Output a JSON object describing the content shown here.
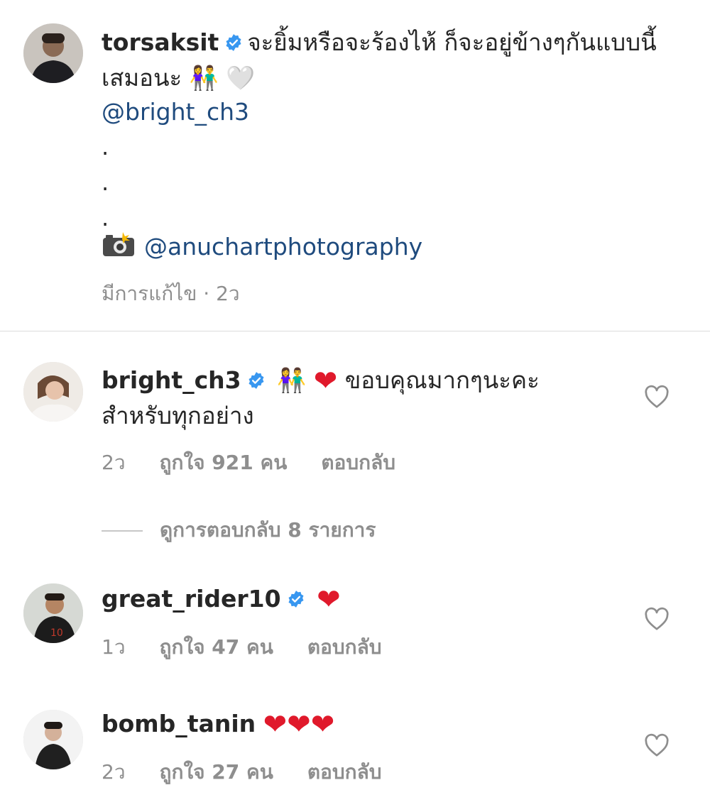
{
  "caption": {
    "username": "torsaksit",
    "text_line1": "จะยิ้มหรือจะร้องไห้ ก็จะอยู่ข้างๆกันแบบนี้",
    "text_line2": "เสมอนะ",
    "emoji_couple": "👫",
    "emoji_heart": "🤍",
    "mention": "@bright_ch3",
    "dots": [
      ".",
      ".",
      "."
    ],
    "photo_credit": "@anuchartphotography",
    "edited_time": "มีการแก้ไข · 2ว"
  },
  "comments": [
    {
      "username": "bright_ch3",
      "verified": true,
      "emoji": "👫",
      "heart": "❤",
      "text_line1": "ขอบคุณมากๆนะคะ",
      "text_line2": "สำหรับทุกอย่าง",
      "time": "2ว",
      "likes": "ถูกใจ 921 คน",
      "reply": "ตอบกลับ"
    },
    {
      "username": "great_rider10",
      "verified": true,
      "heart": "❤",
      "time": "1ว",
      "likes": "ถูกใจ 47 คน",
      "reply": "ตอบกลับ"
    },
    {
      "username": "bomb_tanin",
      "verified": false,
      "hearts": "❤❤❤",
      "time": "2ว",
      "likes": "ถูกใจ 27 คน",
      "reply": "ตอบกลับ"
    }
  ],
  "view_replies": "ดูการตอบกลับ 8 รายการ",
  "colors": {
    "mention": "#1f4b7e",
    "verified": "#3897f0",
    "meta_gray": "#8e8e8e",
    "heart_red": "#e0192b"
  }
}
